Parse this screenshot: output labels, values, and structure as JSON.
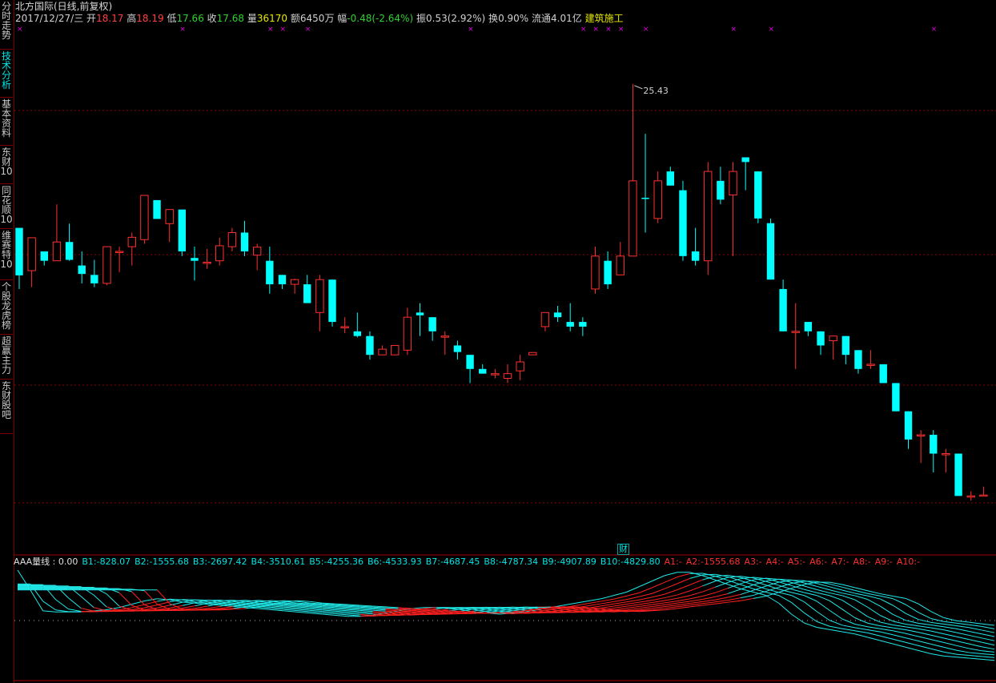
{
  "sidebar": {
    "tabs": [
      {
        "label": "分时走势",
        "active": false
      },
      {
        "label": "技术分析",
        "active": true
      },
      {
        "label": "基本资料",
        "active": false
      },
      {
        "label": "东财10",
        "active": false
      },
      {
        "label": "同花顺10",
        "active": false
      },
      {
        "label": "维赛特10",
        "active": false
      },
      {
        "label": "个股龙虎榜",
        "active": false
      },
      {
        "label": "超赢主力",
        "active": false
      },
      {
        "label": "东财股吧",
        "active": false
      }
    ]
  },
  "header": {
    "title": "北方国际(日线,前复权)",
    "date": "2017/12/27/三",
    "open_label": "开",
    "open": "18.17",
    "high_label": "高",
    "high": "18.19",
    "low_label": "低",
    "low": "17.66",
    "close_label": "收",
    "close": "17.68",
    "vol_label": "量",
    "vol": "36170",
    "amount_label": "额",
    "amount": "6450万",
    "change_label": "幅",
    "change": "-0.48(-2.64%)",
    "amp_label": "振",
    "amp": "0.53(2.92%)",
    "turnover_label": "换",
    "turnover": "0.90%",
    "float_label": "流通",
    "float": "4.01亿",
    "sector": "建筑施工"
  },
  "colors": {
    "up": "#ff3030",
    "down": "#00ffff",
    "grid": "#8b0000",
    "marker": "#e000e0",
    "neutral": "#ffffff"
  },
  "chart_data": [
    {
      "type": "candlestick",
      "title": "北方国际(日线,前复权)",
      "max_label": "25.43",
      "ylim": [
        17.0,
        26.5
      ],
      "candles": [
        {
          "o": 22.37,
          "h": 22.35,
          "l": 21.07,
          "c": 21.36
        },
        {
          "o": 21.46,
          "h": 22.16,
          "l": 21.11,
          "c": 22.16
        },
        {
          "o": 21.87,
          "h": 21.87,
          "l": 21.57,
          "c": 21.67
        },
        {
          "o": 21.67,
          "h": 22.87,
          "l": 21.67,
          "c": 22.07
        },
        {
          "o": 22.07,
          "h": 22.46,
          "l": 21.67,
          "c": 21.69
        },
        {
          "o": 21.57,
          "h": 21.87,
          "l": 21.19,
          "c": 21.39
        },
        {
          "o": 21.37,
          "h": 21.69,
          "l": 21.11,
          "c": 21.19
        },
        {
          "o": 21.19,
          "h": 21.97,
          "l": 21.15,
          "c": 21.97
        },
        {
          "o": 21.87,
          "h": 21.97,
          "l": 21.43,
          "c": 21.87
        },
        {
          "o": 21.97,
          "h": 22.27,
          "l": 21.57,
          "c": 22.17
        },
        {
          "o": 22.12,
          "h": 23.06,
          "l": 22.03,
          "c": 23.06
        },
        {
          "o": 22.96,
          "h": 22.96,
          "l": 22.56,
          "c": 22.56
        },
        {
          "o": 22.46,
          "h": 22.76,
          "l": 22.07,
          "c": 22.76
        },
        {
          "o": 22.76,
          "h": 22.76,
          "l": 21.77,
          "c": 21.87
        },
        {
          "o": 21.73,
          "h": 21.97,
          "l": 21.25,
          "c": 21.67
        },
        {
          "o": 21.64,
          "h": 21.92,
          "l": 21.5,
          "c": 21.64
        },
        {
          "o": 21.67,
          "h": 22.16,
          "l": 21.57,
          "c": 21.99
        },
        {
          "o": 21.97,
          "h": 22.37,
          "l": 21.87,
          "c": 22.27
        },
        {
          "o": 22.27,
          "h": 22.52,
          "l": 21.77,
          "c": 21.87
        },
        {
          "o": 21.79,
          "h": 22.03,
          "l": 21.47,
          "c": 21.96
        },
        {
          "o": 21.67,
          "h": 21.97,
          "l": 20.97,
          "c": 21.17
        },
        {
          "o": 21.37,
          "h": 21.37,
          "l": 21.07,
          "c": 21.17
        },
        {
          "o": 21.17,
          "h": 21.29,
          "l": 20.97,
          "c": 21.27
        },
        {
          "o": 21.17,
          "h": 21.37,
          "l": 20.77,
          "c": 20.77
        },
        {
          "o": 20.57,
          "h": 21.37,
          "l": 20.17,
          "c": 21.27
        },
        {
          "o": 21.27,
          "h": 21.27,
          "l": 20.27,
          "c": 20.37
        },
        {
          "o": 20.27,
          "h": 20.47,
          "l": 20.13,
          "c": 20.27
        },
        {
          "o": 20.17,
          "h": 20.57,
          "l": 20.04,
          "c": 20.07
        },
        {
          "o": 20.07,
          "h": 20.17,
          "l": 19.57,
          "c": 19.67
        },
        {
          "o": 19.67,
          "h": 19.87,
          "l": 19.67,
          "c": 19.79
        },
        {
          "o": 19.67,
          "h": 19.87,
          "l": 19.67,
          "c": 19.87
        },
        {
          "o": 19.77,
          "h": 20.67,
          "l": 19.67,
          "c": 20.47
        },
        {
          "o": 20.57,
          "h": 20.77,
          "l": 20.07,
          "c": 20.51
        },
        {
          "o": 20.47,
          "h": 20.47,
          "l": 19.97,
          "c": 20.17
        },
        {
          "o": 20.07,
          "h": 20.17,
          "l": 19.67,
          "c": 20.07
        },
        {
          "o": 19.87,
          "h": 19.97,
          "l": 19.57,
          "c": 19.73
        },
        {
          "o": 19.67,
          "h": 19.67,
          "l": 19.07,
          "c": 19.37
        },
        {
          "o": 19.37,
          "h": 19.47,
          "l": 19.27,
          "c": 19.27
        },
        {
          "o": 19.27,
          "h": 19.37,
          "l": 19.17,
          "c": 19.27
        },
        {
          "o": 19.17,
          "h": 19.47,
          "l": 19.07,
          "c": 19.27
        },
        {
          "o": 19.33,
          "h": 19.67,
          "l": 19.13,
          "c": 19.52
        },
        {
          "o": 19.67,
          "h": 19.72,
          "l": 19.67,
          "c": 19.72
        },
        {
          "o": 20.27,
          "h": 20.57,
          "l": 20.17,
          "c": 20.57
        },
        {
          "o": 20.57,
          "h": 20.71,
          "l": 20.37,
          "c": 20.47
        },
        {
          "o": 20.37,
          "h": 20.77,
          "l": 20.17,
          "c": 20.27
        },
        {
          "o": 20.37,
          "h": 20.47,
          "l": 20.07,
          "c": 20.27
        },
        {
          "o": 21.07,
          "h": 21.97,
          "l": 20.97,
          "c": 21.77
        },
        {
          "o": 21.67,
          "h": 21.87,
          "l": 21.07,
          "c": 21.17
        },
        {
          "o": 21.37,
          "h": 22.07,
          "l": 21.37,
          "c": 21.77
        },
        {
          "o": 21.77,
          "h": 25.43,
          "l": 21.77,
          "c": 23.37
        },
        {
          "o": 23.01,
          "h": 24.37,
          "l": 22.27,
          "c": 22.99
        },
        {
          "o": 22.57,
          "h": 23.57,
          "l": 22.47,
          "c": 23.37
        },
        {
          "o": 23.57,
          "h": 23.67,
          "l": 23.27,
          "c": 23.27
        },
        {
          "o": 23.17,
          "h": 23.37,
          "l": 21.67,
          "c": 21.77
        },
        {
          "o": 21.87,
          "h": 22.37,
          "l": 21.57,
          "c": 21.67
        },
        {
          "o": 21.67,
          "h": 23.77,
          "l": 21.37,
          "c": 23.57
        },
        {
          "o": 23.37,
          "h": 23.67,
          "l": 22.87,
          "c": 22.97
        },
        {
          "o": 23.07,
          "h": 23.77,
          "l": 21.77,
          "c": 23.57
        },
        {
          "o": 23.87,
          "h": 23.87,
          "l": 23.17,
          "c": 23.77
        },
        {
          "o": 23.57,
          "h": 23.57,
          "l": 22.47,
          "c": 22.57
        },
        {
          "o": 22.47,
          "h": 22.57,
          "l": 21.27,
          "c": 21.27
        },
        {
          "o": 21.07,
          "h": 21.27,
          "l": 20.17,
          "c": 20.17
        },
        {
          "o": 20.17,
          "h": 20.77,
          "l": 19.37,
          "c": 20.17
        },
        {
          "o": 20.37,
          "h": 20.37,
          "l": 20.07,
          "c": 20.17
        },
        {
          "o": 20.17,
          "h": 20.17,
          "l": 19.67,
          "c": 19.87
        },
        {
          "o": 19.97,
          "h": 20.07,
          "l": 19.57,
          "c": 20.07
        },
        {
          "o": 20.07,
          "h": 20.07,
          "l": 19.47,
          "c": 19.67
        },
        {
          "o": 19.77,
          "h": 19.77,
          "l": 19.27,
          "c": 19.37
        },
        {
          "o": 19.47,
          "h": 19.77,
          "l": 19.37,
          "c": 19.47
        },
        {
          "o": 19.47,
          "h": 19.47,
          "l": 19.07,
          "c": 19.07
        },
        {
          "o": 19.07,
          "h": 19.07,
          "l": 18.47,
          "c": 18.47
        },
        {
          "o": 18.47,
          "h": 18.47,
          "l": 17.67,
          "c": 17.87
        },
        {
          "o": 17.97,
          "h": 18.07,
          "l": 17.37,
          "c": 17.97
        },
        {
          "o": 17.97,
          "h": 18.07,
          "l": 17.17,
          "c": 17.57
        },
        {
          "o": 17.57,
          "h": 17.67,
          "l": 17.17,
          "c": 17.57
        },
        {
          "o": 17.57,
          "h": 17.57,
          "l": 16.67,
          "c": 16.67
        },
        {
          "o": 16.67,
          "h": 16.77,
          "l": 16.57,
          "c": 16.67
        },
        {
          "o": 16.68,
          "h": 16.87,
          "l": 16.67,
          "c": 16.69
        }
      ],
      "markers_x_index": [
        0,
        13,
        20,
        21,
        23,
        36,
        45,
        46,
        47,
        48,
        50,
        57,
        60,
        73
      ]
    },
    {
      "type": "line",
      "title": "AAA量线",
      "legend": [
        {
          "name": "AAA量线",
          "value": "0.00"
        },
        {
          "name": "B1",
          "value": "-828.07"
        },
        {
          "name": "B2",
          "value": "-1555.68"
        },
        {
          "name": "B3",
          "value": "-2697.42"
        },
        {
          "name": "B4",
          "value": "-3510.61"
        },
        {
          "name": "B5",
          "value": "-4255.36"
        },
        {
          "name": "B6",
          "value": "-4533.93"
        },
        {
          "name": "B7",
          "value": "-4687.45"
        },
        {
          "name": "B8",
          "value": "-4787.34"
        },
        {
          "name": "B9",
          "value": "-4907.89"
        },
        {
          "name": "B10",
          "value": "-4829.80"
        },
        {
          "name": "A1",
          "value": "-"
        },
        {
          "name": "A2",
          "value": "-1555.68"
        },
        {
          "name": "A3",
          "value": "-"
        },
        {
          "name": "A4",
          "value": "-"
        },
        {
          "name": "A5",
          "value": "-"
        },
        {
          "name": "A6",
          "value": "-"
        },
        {
          "name": "A7",
          "value": "-"
        },
        {
          "name": "A8",
          "value": "-"
        },
        {
          "name": "A9",
          "value": "-"
        },
        {
          "name": "A10",
          "value": "-"
        }
      ],
      "base_curve": [
        1.0,
        0.1,
        -0.25,
        -0.3,
        -0.3,
        -0.3,
        -0.25,
        -0.2,
        -0.1,
        0.05,
        0.2,
        0.3,
        0.25,
        0.15,
        0.1,
        0.05,
        0.0,
        -0.05,
        -0.1,
        -0.15,
        -0.2,
        -0.25,
        -0.3,
        -0.35,
        -0.4,
        -0.45,
        -0.5,
        -0.5,
        -0.45,
        -0.35,
        -0.25,
        -0.15,
        -0.1,
        -0.1,
        -0.15,
        -0.2,
        -0.3,
        -0.35,
        -0.4,
        -0.35,
        -0.3,
        -0.2,
        -0.1,
        0.0,
        0.1,
        0.2,
        0.3,
        0.45,
        0.6,
        0.85,
        1.1,
        1.35,
        1.5,
        1.5,
        1.35,
        1.15,
        0.95,
        0.75,
        0.6,
        0.45,
        0.1,
        -0.4,
        -0.8,
        -1.0,
        -1.1,
        -1.2,
        -1.3,
        -1.45,
        -1.6,
        -1.75,
        -1.9,
        -2.05,
        -2.2,
        -2.3,
        -2.35,
        -2.4,
        -2.45,
        -2.5
      ],
      "ylim": [
        -3.2,
        2.0
      ]
    }
  ],
  "indicator": {
    "cai_label": "财"
  }
}
